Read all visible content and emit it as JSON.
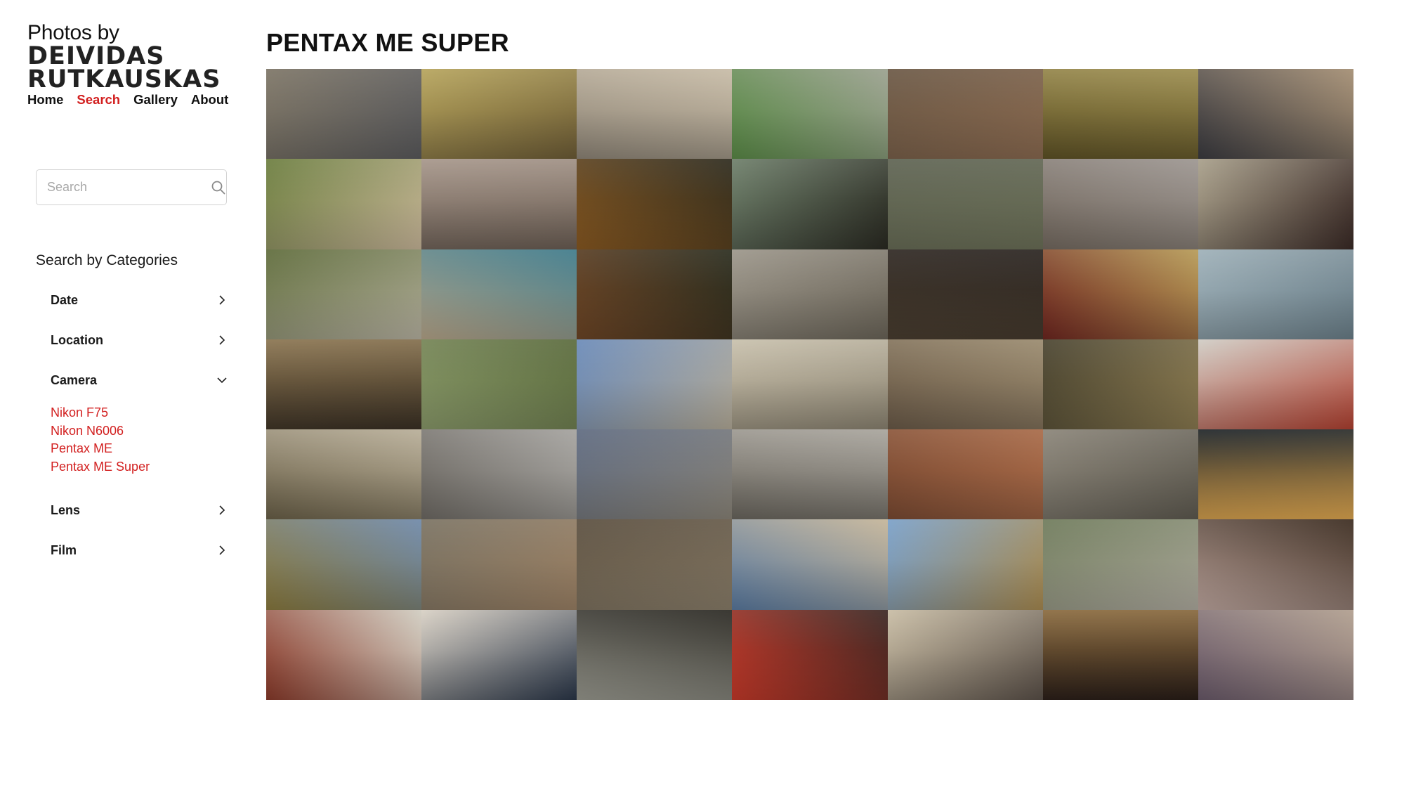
{
  "brand": {
    "line1": "Photos by",
    "line2": "DEIVIDAS",
    "line3": "RUTKAUSKAS"
  },
  "nav": {
    "items": [
      "Home",
      "Search",
      "Gallery",
      "About"
    ],
    "active": "Search"
  },
  "search": {
    "placeholder": "Search",
    "value": ""
  },
  "categories": {
    "title": "Search by Categories",
    "items": [
      "Date",
      "Location",
      "Camera",
      "Lens",
      "Film"
    ],
    "expanded": "Camera",
    "camera_options": [
      "Nikon F75",
      "Nikon N6006",
      "Pentax ME",
      "Pentax ME Super"
    ]
  },
  "page": {
    "title": "PENTAX ME SUPER"
  },
  "colors": {
    "accent": "#d21f1f",
    "text": "#111111",
    "border": "#d3d3d3"
  },
  "photos": [
    {
      "c1": "#7d7566",
      "c2": "#5a5a5c"
    },
    {
      "c1": "#b6a45c",
      "c2": "#6d5c36"
    },
    {
      "c1": "#c7bba6",
      "c2": "#8e8577"
    },
    {
      "c1": "#9aa08e",
      "c2": "#5a8a47"
    },
    {
      "c1": "#6b5845",
      "c2": "#8a6a50"
    },
    {
      "c1": "#9c8d4f",
      "c2": "#5e5226"
    },
    {
      "c1": "#a38d72",
      "c2": "#3b3b40"
    },
    {
      "c1": "#6b7d3e",
      "c2": "#c9b79a"
    },
    {
      "c1": "#a6968a",
      "c2": "#6b5e54"
    },
    {
      "c1": "#2d2a1d",
      "c2": "#8a5a22"
    },
    {
      "c1": "#6e7f6a",
      "c2": "#2a2a22"
    },
    {
      "c1": "#5e6352",
      "c2": "#6c7058"
    },
    {
      "c1": "#9c9590",
      "c2": "#746a60"
    },
    {
      "c1": "#a89f8a",
      "c2": "#3a2a26"
    },
    {
      "c1": "#5e6b3a",
      "c2": "#b8b3a2"
    },
    {
      "c1": "#3e7a8a",
      "c2": "#b7a68a"
    },
    {
      "c1": "#2a2c1e",
      "c2": "#6e4626"
    },
    {
      "c1": "#9c968a",
      "c2": "#6a6458"
    },
    {
      "c1": "#2a2420",
      "c2": "#4a3e30"
    },
    {
      "c1": "#b69a56",
      "c2": "#6e2620"
    },
    {
      "c1": "#9eb0b8",
      "c2": "#6a7e88"
    },
    {
      "c1": "#8a7450",
      "c2": "#3a3024"
    },
    {
      "c1": "#5a6a3c",
      "c2": "#8a9a6a"
    },
    {
      "c1": "#6a8ab8",
      "c2": "#b4ab98"
    },
    {
      "c1": "#c8c0ac",
      "c2": "#8a8270"
    },
    {
      "c1": "#9a8a6e",
      "c2": "#6a5a48"
    },
    {
      "c1": "#4a4430",
      "c2": "#8a7a50"
    },
    {
      "c1": "#d0ccc4",
      "c2": "#b04030"
    },
    {
      "c1": "#b8ae98",
      "c2": "#6a6048"
    },
    {
      "c1": "#a4a29e",
      "c2": "#6e6a64"
    },
    {
      "c1": "#5e6a80",
      "c2": "#8a8478"
    },
    {
      "c1": "#a8a49c",
      "c2": "#6a665e"
    },
    {
      "c1": "#a86a48",
      "c2": "#7a4a32"
    },
    {
      "c1": "#8a8478",
      "c2": "#5e5a50"
    },
    {
      "c1": "#1e2428",
      "c2": "#e0a850"
    },
    {
      "c1": "#6e88a8",
      "c2": "#8a7a3e"
    },
    {
      "c1": "#7a7262",
      "c2": "#9a8064"
    },
    {
      "c1": "#5a4e3e",
      "c2": "#8a7e6a"
    },
    {
      "c1": "#c4b498",
      "c2": "#5a7aa0"
    },
    {
      "c1": "#7aa0c8",
      "c2": "#a88a50"
    },
    {
      "c1": "#6e7a5a",
      "c2": "#b0aca0"
    },
    {
      "c1": "#3a2a1e",
      "c2": "#c0a8a0"
    },
    {
      "c1": "#d0ccc0",
      "c2": "#8a3a2a"
    },
    {
      "c1": "#d8d0c4",
      "c2": "#2a3648"
    },
    {
      "c1": "#2a2822",
      "c2": "#9a9a90"
    },
    {
      "c1": "#3a2622",
      "c2": "#c83a2a"
    },
    {
      "c1": "#c8bca4",
      "c2": "#5a5048"
    },
    {
      "c1": "#8a6a3e",
      "c2": "#2a1e18"
    },
    {
      "c1": "#b09e8e",
      "c2": "#6a5a6a"
    }
  ]
}
